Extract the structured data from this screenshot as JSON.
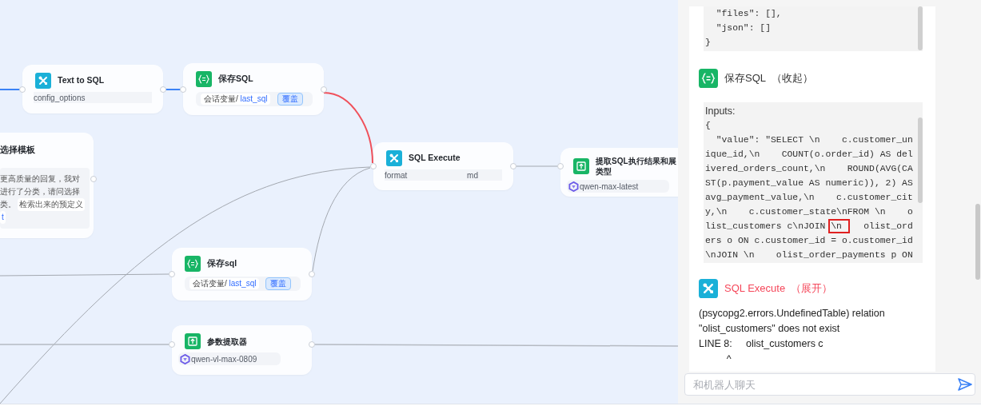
{
  "canvas": {
    "nodes": [
      {
        "kind": "tool",
        "title": "Text to SQL",
        "param": {
          "key": "config_options"
        }
      },
      {
        "kind": "variable",
        "title": "保存SQL",
        "scope": "会话变量/",
        "variable": "last_sql",
        "mode": "覆盖"
      },
      {
        "kind": "template",
        "title": "选择模板",
        "text_lines": [
          "更高质量的回复，我对",
          "进行了分类，请问选择",
          "类。"
        ],
        "tags": [
          "检索出来的预定义",
          "t"
        ]
      },
      {
        "kind": "tool",
        "title": "SQL Execute",
        "param": {
          "key": "format",
          "value": "md"
        }
      },
      {
        "kind": "extractor",
        "title_lines": [
          "提取SQL执行结果和展",
          "类型"
        ],
        "model": "qwen-max-latest"
      },
      {
        "kind": "variable",
        "title": "保存sql",
        "scope": "会话变量/",
        "variable": "last_sql",
        "mode": "覆盖"
      },
      {
        "kind": "extractor",
        "title_lines": [
          "参数提取器"
        ],
        "model": "qwen-vl-max-0809"
      }
    ]
  },
  "chat_panel": {
    "blocks": [
      {
        "kind": "code",
        "lines": [
          "  \"files\": [],",
          "  \"json\": []",
          "}"
        ]
      },
      {
        "kind": "step",
        "title": "保存SQL",
        "toggle": "（收起）",
        "error": false
      },
      {
        "kind": "code",
        "label": "Inputs:",
        "lines": [
          "{",
          "  \"value\": \"SELECT \\n    c.customer_un",
          "ique_id,\\n    COUNT(o.order_id) AS del",
          "ivered_orders_count,\\n    ROUND(AVG(CA",
          "ST(p.payment_value AS numeric)), 2) AS",
          "avg_payment_value,\\n    c.customer_cit",
          "y,\\n    c.customer_state\\nFROM \\n    o",
          {
            "segments": [
              {
                "text": "list_customers c\\nJOIN ",
                "marked": false
              },
              {
                "text": "\\n ",
                "marked": true
              },
              {
                "text": "   olist_ord",
                "marked": false
              }
            ]
          },
          "ers o ON c.customer_id = o.customer_id",
          "\\nJOIN \\n    olist_order_payments p ON"
        ]
      },
      {
        "kind": "step",
        "title": "SQL Execute",
        "toggle": "（展开）",
        "error": true
      },
      {
        "kind": "text",
        "lines": [
          "(psycopg2.errors.UndefinedTable) relation",
          "\"olist_customers\" does not exist",
          "LINE 8:     olist_customers c",
          "          ^"
        ]
      }
    ],
    "input": {
      "placeholder": "和机器人聊天"
    }
  }
}
